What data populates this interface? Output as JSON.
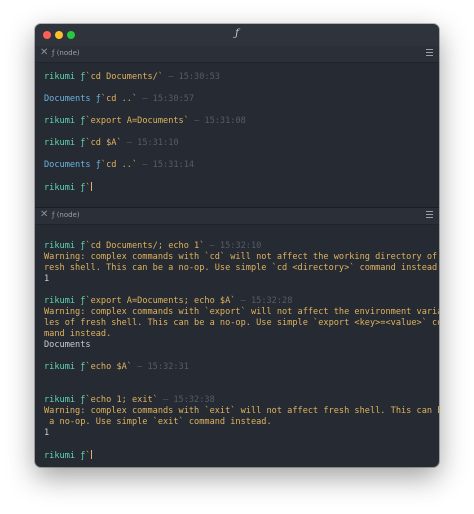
{
  "window": {
    "title": "ƒ"
  },
  "panes": [
    {
      "tab_label": "ƒ (node)",
      "lines": [
        {
          "prompt": "rikumi ƒ",
          "prompt_type": "user",
          "cmd": "`cd Documents/`",
          "time": " – 15:30:53"
        },
        {
          "blank": true
        },
        {
          "prompt": "Documents ƒ",
          "prompt_type": "path",
          "cmd": "`cd ..`",
          "time": " – 15:30:57"
        },
        {
          "blank": true
        },
        {
          "prompt": "rikumi ƒ",
          "prompt_type": "user",
          "cmd": "`export A=Documents`",
          "time": " – 15:31:08"
        },
        {
          "blank": true
        },
        {
          "prompt": "rikumi ƒ",
          "prompt_type": "user",
          "cmd": "`cd $A`",
          "time": " – 15:31:10"
        },
        {
          "blank": true
        },
        {
          "prompt": "Documents ƒ",
          "prompt_type": "path",
          "cmd": "`cd ..`",
          "time": " – 15:31:14"
        },
        {
          "blank": true
        },
        {
          "prompt": "rikumi ƒ",
          "prompt_type": "user",
          "cmd": "`",
          "cursor": true
        }
      ]
    },
    {
      "tab_label": "ƒ (node)",
      "lines": [
        {
          "blank": true
        },
        {
          "prompt": "rikumi ƒ",
          "prompt_type": "user",
          "cmd": "`cd Documents/; echo 1`",
          "time": " – 15:32:10"
        },
        {
          "warn": "Warning: complex commands with `cd` will not affect the working directory of f"
        },
        {
          "warn": "resh shell. This can be a no-op. Use simple `cd <directory>` command instead."
        },
        {
          "out": "1"
        },
        {
          "blank": true
        },
        {
          "prompt": "rikumi ƒ",
          "prompt_type": "user",
          "cmd": "`export A=Documents; echo $A`",
          "time": " – 15:32:28"
        },
        {
          "warn": "Warning: complex commands with `export` will not affect the environment variab"
        },
        {
          "warn": "les of fresh shell. This can be a no-op. Use simple `export <key>=<value>` com"
        },
        {
          "warn": "mand instead."
        },
        {
          "out": "Documents"
        },
        {
          "blank": true
        },
        {
          "prompt": "rikumi ƒ",
          "prompt_type": "user",
          "cmd": "`echo $A`",
          "time": " – 15:32:31"
        },
        {
          "blank": true
        },
        {
          "blank": true
        },
        {
          "prompt": "rikumi ƒ",
          "prompt_type": "user",
          "cmd": "`echo 1; exit`",
          "time": " – 15:32:38"
        },
        {
          "warn": "Warning: complex commands with `exit` will not affect fresh shell. This can be"
        },
        {
          "warn": " a no-op. Use simple `exit` command instead."
        },
        {
          "out": "1"
        },
        {
          "blank": true
        },
        {
          "prompt": "rikumi ƒ",
          "prompt_type": "user",
          "cmd": "`",
          "cursor": true
        }
      ]
    }
  ],
  "colors": {
    "background": "#252a33",
    "prompt_user": "#5fd7af",
    "prompt_path": "#6cb4e0",
    "command": "#e0b35e",
    "timestamp": "#555d69",
    "output": "#c9ccd2"
  }
}
